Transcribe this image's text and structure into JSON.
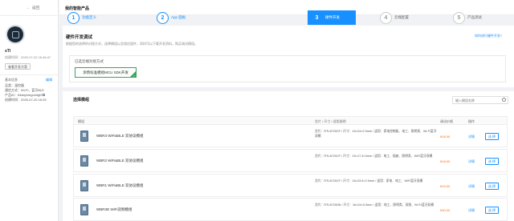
{
  "sidebar": {
    "back_label": "返回",
    "product_name": "sTl",
    "created_date": "创建时间：2020-07-20 16:46:47",
    "tag_button": "查看开发方案",
    "basic_info_title": "基本信息",
    "edit_label": "编辑",
    "info": [
      "品类：温控器",
      "通信方式：Wi-Fi、蓝牙BLE",
      "产品ID：tl3abyhmgnmfgl9",
      "创建时间：2020-07-20 16:39"
    ]
  },
  "header": {
    "title": "我的智能产品"
  },
  "steps": [
    {
      "num": "1",
      "label": "功能定义",
      "state": "done"
    },
    {
      "num": "2",
      "label": "App 面板",
      "state": "done"
    },
    {
      "num": "3",
      "label": "硬件开发",
      "state": "active"
    },
    {
      "num": "4",
      "label": "云端配置",
      "state": "todo"
    },
    {
      "num": "5",
      "label": "产品测试",
      "state": "todo"
    }
  ],
  "main": {
    "section_title": "硬件开发调试",
    "section_desc": "根据您的选择的对接方式，选择模组以及相应固件，同时可以下载开发资料，购买调试模组。",
    "help_link": "如何进行硬件开发?",
    "method_label": "已选云端对接方式",
    "method_value": "涂鸦标准模组MCU SDK开发",
    "modules_title": "选择模组",
    "search_placeholder": "输入模组名称",
    "table_headers": {
      "module": "模组",
      "spec": "芯片 / 尺寸 / 适用说明",
      "price": "调试价格",
      "action": "操作"
    },
    "rows": [
      {
        "name": "WBR3 WiFi&BLE 双协议模组",
        "spec": "芯片：RTL8720CF / 尺寸：16×24×2.9mm / 适用：家电控制板、电工、照明类、Wi-Fi蓝牙双模",
        "price": "¥18.00",
        "detail": "详情",
        "select": "选 择"
      },
      {
        "name": "WBR2 WiFi&BLE 双协议模组",
        "spec": "芯片：RTL8720CF / 尺寸：15×17.3×3mm / 适用：电工、插座、照明类、WiFi蓝牙双模",
        "price": "¥18.00",
        "detail": "详情",
        "select": "选 择"
      },
      {
        "name": "WBR1 WiFi&BLE 双协议模组",
        "spec": "芯片：RTL8720CF / 尺寸：16×23.5×2.9mm / 适用：家电、电工、WiFi蓝牙双模",
        "price": "¥19.00",
        "detail": "详情",
        "select": "选 择"
      },
      {
        "name": "WBR3D WiFi双频模组",
        "spec": "芯片：RTL8720DN / 尺寸：16×24×3.3mm / 适用：电工、照明类、双频、Wi-Fi蓝牙双模",
        "price": "¥30.00",
        "detail": "详情",
        "select": "选 择"
      }
    ]
  },
  "colors": {
    "accent": "#1890ff",
    "price": "#ff6a00",
    "selected_border": "#3aa55a"
  }
}
